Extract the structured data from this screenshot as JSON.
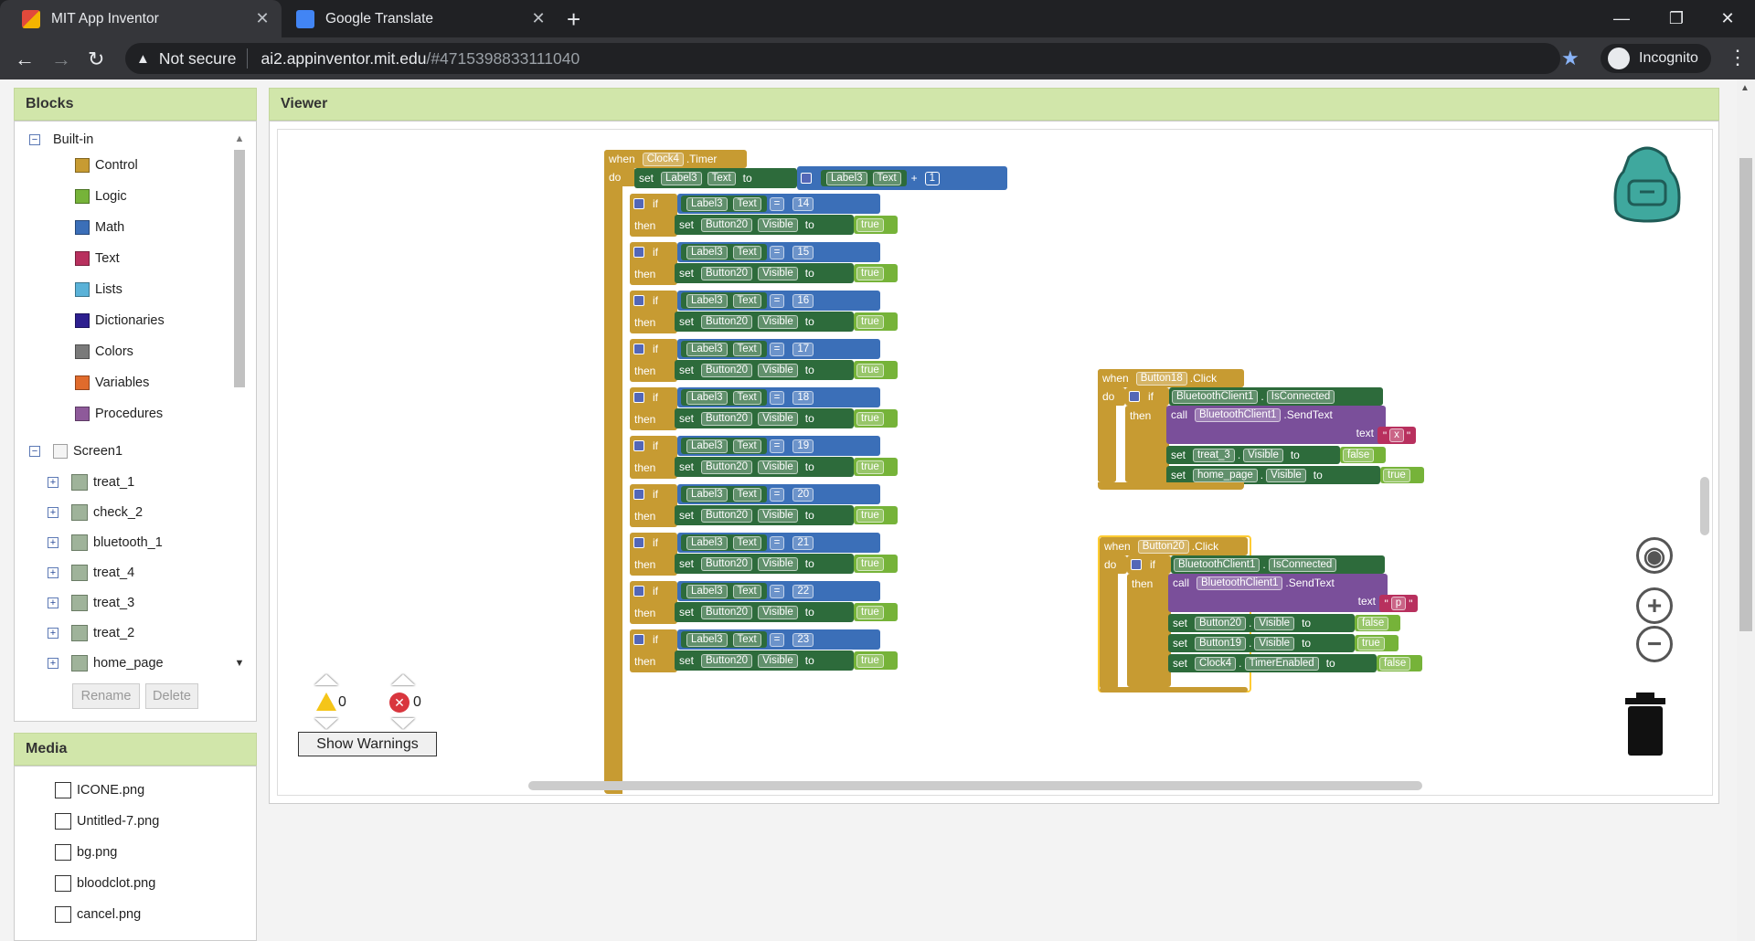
{
  "browser": {
    "tabs": [
      {
        "title": "MIT App Inventor",
        "active": true
      },
      {
        "title": "Google Translate",
        "active": false
      }
    ],
    "security": "Not secure",
    "url_host": "ai2.appinventor.mit.edu",
    "url_path": "/#4715398833111040",
    "profile": "Incognito"
  },
  "blocks_panel": {
    "title": "Blocks",
    "builtin_label": "Built-in",
    "builtin": [
      {
        "label": "Control",
        "color": "#c79b32"
      },
      {
        "label": "Logic",
        "color": "#76b339"
      },
      {
        "label": "Math",
        "color": "#3b6fb8"
      },
      {
        "label": "Text",
        "color": "#b8305e"
      },
      {
        "label": "Lists",
        "color": "#5ab2d8"
      },
      {
        "label": "Dictionaries",
        "color": "#2d1f8f"
      },
      {
        "label": "Colors",
        "color": "#7a7a7a"
      },
      {
        "label": "Variables",
        "color": "#e06b2c"
      },
      {
        "label": "Procedures",
        "color": "#8e5a9a"
      }
    ],
    "screen_label": "Screen1",
    "components": [
      "treat_1",
      "check_2",
      "bluetooth_1",
      "treat_4",
      "treat_3",
      "treat_2",
      "home_page"
    ],
    "rename_label": "Rename",
    "delete_label": "Delete"
  },
  "media_panel": {
    "title": "Media",
    "files": [
      "ICONE.png",
      "Untitled-7.png",
      "bg.png",
      "bloodclot.png",
      "cancel.png"
    ]
  },
  "viewer": {
    "title": "Viewer",
    "warnings_count": "0",
    "errors_count": "0",
    "show_warnings_label": "Show Warnings",
    "timer_block": {
      "when": "when",
      "component": "Clock4",
      "event": ".Timer",
      "do": "do",
      "set": "set",
      "label": "Label3",
      "prop": "Text",
      "to": "to",
      "plus": "+",
      "one": "1",
      "if": "if",
      "then": "then",
      "eq": "=",
      "button": "Button20",
      "visible": "Visible",
      "true": "true",
      "values": [
        "14",
        "15",
        "16",
        "17",
        "18",
        "19",
        "20",
        "21",
        "22",
        "23"
      ]
    },
    "b18_block": {
      "when": "when",
      "component": "Button18",
      "event": ".Click",
      "do": "do",
      "if": "if",
      "then": "then",
      "bt": "BluetoothClient1",
      "isconn": "IsConnected",
      "call": "call",
      "sendtext": ".SendText",
      "text": "text",
      "char": "x",
      "set1_comp": "treat_3",
      "set1_prop": "Visible",
      "set1_val": "false",
      "set2_comp": "home_page",
      "set2_prop": "Visible",
      "set2_val": "true",
      "set": "set",
      "to": "to"
    },
    "b20_block": {
      "when": "when",
      "component": "Button20",
      "event": ".Click",
      "do": "do",
      "if": "if",
      "then": "then",
      "bt": "BluetoothClient1",
      "isconn": "IsConnected",
      "call": "call",
      "sendtext": ".SendText",
      "text": "text",
      "char": "p",
      "set1_comp": "Button20",
      "set1_prop": "Visible",
      "set1_val": "false",
      "set2_comp": "Button19",
      "set2_prop": "Visible",
      "set2_val": "true",
      "set3_comp": "Clock4",
      "set3_prop": "TimerEnabled",
      "set3_val": "false",
      "set": "set",
      "to": "to"
    }
  }
}
